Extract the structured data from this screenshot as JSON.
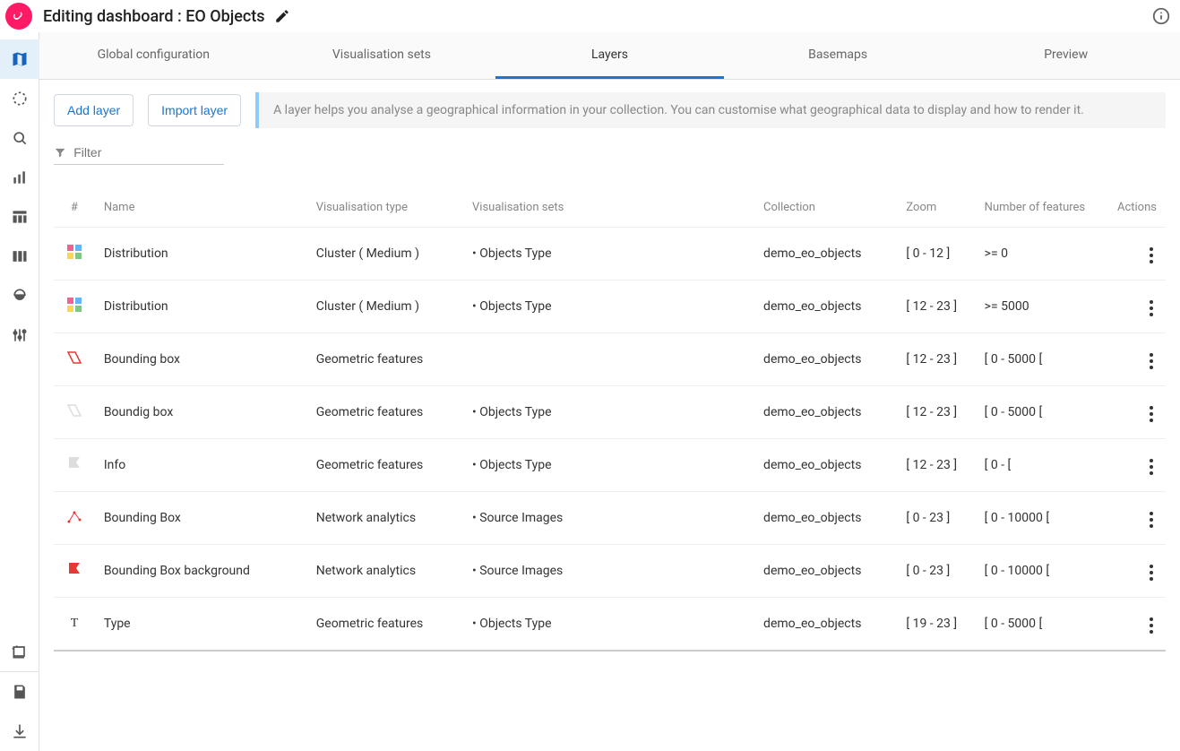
{
  "header": {
    "title": "Editing dashboard : EO Objects"
  },
  "tabs": [
    {
      "label": "Global configuration",
      "active": false
    },
    {
      "label": "Visualisation sets",
      "active": false
    },
    {
      "label": "Layers",
      "active": true
    },
    {
      "label": "Basemaps",
      "active": false
    },
    {
      "label": "Preview",
      "active": false
    }
  ],
  "toolbar": {
    "add_layer": "Add layer",
    "import_layer": "Import layer",
    "help_text": "A layer helps you analyse a geographical information in your collection. You can customise what geographical data to display and how to render it."
  },
  "filter": {
    "placeholder": "Filter",
    "value": ""
  },
  "columns": {
    "idx": "#",
    "name": "Name",
    "vtype": "Visualisation type",
    "vsets": "Visualisation sets",
    "collection": "Collection",
    "zoom": "Zoom",
    "nfeatures": "Number of features",
    "actions": "Actions"
  },
  "rows": [
    {
      "icon": "grid-color",
      "name": "Distribution",
      "vtype": "Cluster ( Medium )",
      "vsets": "• Objects Type",
      "collection": "demo_eo_objects",
      "zoom": "[ 0 - 12 ]",
      "nfeatures": ">= 0"
    },
    {
      "icon": "grid-color",
      "name": "Distribution",
      "vtype": "Cluster ( Medium )",
      "vsets": "• Objects Type",
      "collection": "demo_eo_objects",
      "zoom": "[ 12 - 23 ]",
      "nfeatures": ">= 5000"
    },
    {
      "icon": "poly-red",
      "name": "Bounding box",
      "vtype": "Geometric features",
      "vsets": "",
      "collection": "demo_eo_objects",
      "zoom": "[ 12 - 23 ]",
      "nfeatures": "[ 0 - 5000 ["
    },
    {
      "icon": "poly-gray",
      "name": "Boundig box",
      "vtype": "Geometric features",
      "vsets": "• Objects Type",
      "collection": "demo_eo_objects",
      "zoom": "[ 12 - 23 ]",
      "nfeatures": "[ 0 - 5000 ["
    },
    {
      "icon": "flag-gray",
      "name": "Info",
      "vtype": "Geometric features",
      "vsets": "• Objects Type",
      "collection": "demo_eo_objects",
      "zoom": "[ 12 - 23 ]",
      "nfeatures": "[ 0 - ["
    },
    {
      "icon": "net-red",
      "name": "Bounding Box",
      "vtype": "Network analytics",
      "vsets": "• Source Images",
      "collection": "demo_eo_objects",
      "zoom": "[ 0 - 23 ]",
      "nfeatures": "[ 0 - 10000 ["
    },
    {
      "icon": "flag-red",
      "name": "Bounding Box background",
      "vtype": "Network analytics",
      "vsets": "• Source Images",
      "collection": "demo_eo_objects",
      "zoom": "[ 0 - 23 ]",
      "nfeatures": "[ 0 - 10000 ["
    },
    {
      "icon": "letter-t",
      "name": "Type",
      "vtype": "Geometric features",
      "vsets": "• Objects Type",
      "collection": "demo_eo_objects",
      "zoom": "[ 19 - 23 ]",
      "nfeatures": "[ 0 - 5000 ["
    }
  ]
}
